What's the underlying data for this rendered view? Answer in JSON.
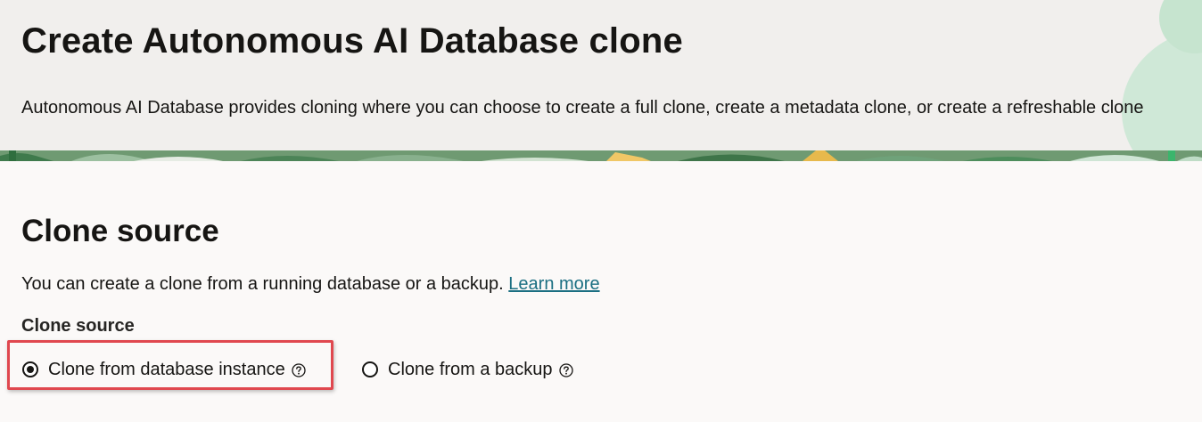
{
  "header": {
    "title": "Create Autonomous AI Database clone",
    "description": "Autonomous AI Database provides cloning where you can choose to create a full clone, create a metadata clone, or create a refreshable clone"
  },
  "clone_source_section": {
    "title": "Clone source",
    "description": "You can create a clone from a running database or a backup.",
    "learn_more": "Learn more",
    "field_label": "Clone source",
    "options": [
      {
        "label": "Clone from database instance",
        "selected": true,
        "icon": "help-icon"
      },
      {
        "label": "Clone from a backup",
        "selected": false,
        "icon": "help-icon"
      }
    ]
  },
  "colors": {
    "link": "#1b6f82",
    "highlight": "#e0484f",
    "banner_green": "#5c8a62"
  }
}
